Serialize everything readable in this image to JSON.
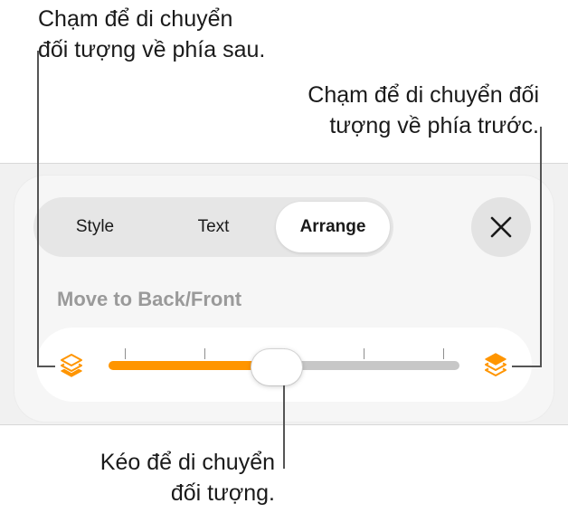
{
  "callouts": {
    "back": {
      "line1": "Chạm để di chuyển",
      "line2": "đối tượng về phía sau."
    },
    "front": {
      "line1": "Chạm để di chuyển đối",
      "line2": "tượng về phía trước."
    },
    "drag": {
      "line1": "Kéo để di chuyển",
      "line2": "đối tượng."
    }
  },
  "tabs": [
    {
      "label": "Style"
    },
    {
      "label": "Text"
    },
    {
      "label": "Arrange"
    }
  ],
  "active_tab": "Arrange",
  "close_icon": "xmark-icon",
  "section": {
    "label": "Move to Back/Front"
  },
  "slider": {
    "value_fraction": 0.48,
    "tick_count": 5,
    "back_icon": "layers-back-icon",
    "front_icon": "layers-front-icon"
  },
  "colors": {
    "accent": "#ff9500",
    "track": "#c7c7c7",
    "panel": "#f1f1f1"
  }
}
